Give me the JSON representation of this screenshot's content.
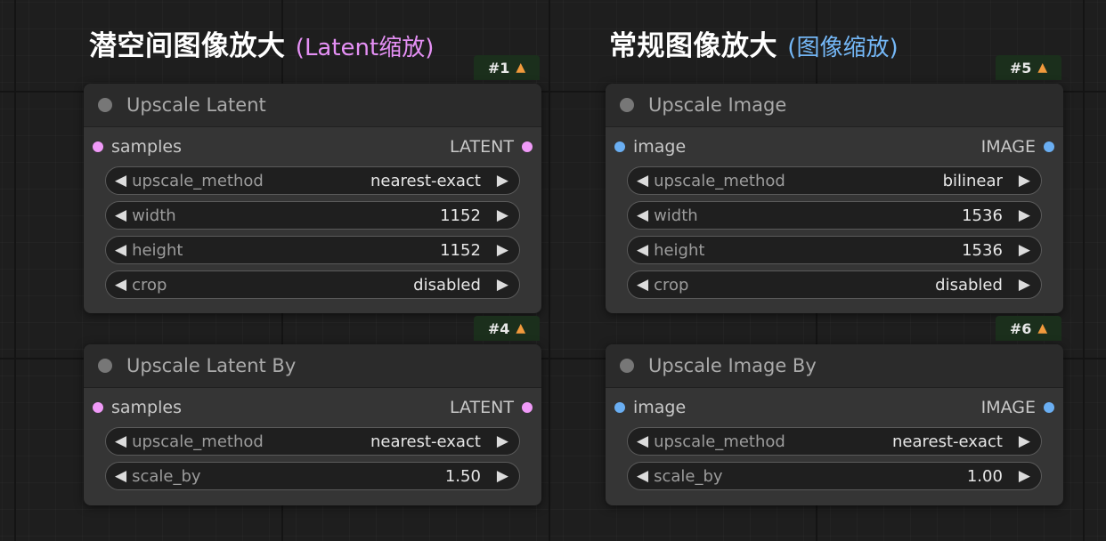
{
  "left_group": {
    "heading": "潜空间图像放大",
    "subheading": "(Latent缩放)",
    "nodes": [
      {
        "badge": "#1",
        "title": "Upscale Latent",
        "input_label": "samples",
        "output_label": "LATENT",
        "widgets": [
          {
            "name": "upscale_method",
            "value": "nearest-exact"
          },
          {
            "name": "width",
            "value": "1152"
          },
          {
            "name": "height",
            "value": "1152"
          },
          {
            "name": "crop",
            "value": "disabled"
          }
        ]
      },
      {
        "badge": "#4",
        "title": "Upscale Latent By",
        "input_label": "samples",
        "output_label": "LATENT",
        "widgets": [
          {
            "name": "upscale_method",
            "value": "nearest-exact"
          },
          {
            "name": "scale_by",
            "value": "1.50"
          }
        ]
      }
    ]
  },
  "right_group": {
    "heading": "常规图像放大",
    "subheading": "(图像缩放)",
    "nodes": [
      {
        "badge": "#5",
        "title": "Upscale Image",
        "input_label": "image",
        "output_label": "IMAGE",
        "widgets": [
          {
            "name": "upscale_method",
            "value": "bilinear"
          },
          {
            "name": "width",
            "value": "1536"
          },
          {
            "name": "height",
            "value": "1536"
          },
          {
            "name": "crop",
            "value": "disabled"
          }
        ]
      },
      {
        "badge": "#6",
        "title": "Upscale Image By",
        "input_label": "image",
        "output_label": "IMAGE",
        "widgets": [
          {
            "name": "upscale_method",
            "value": "nearest-exact"
          },
          {
            "name": "scale_by",
            "value": "1.00"
          }
        ]
      }
    ]
  },
  "icons": {
    "badge_icon": "fox-icon",
    "collapse_icon": "node-collapse-dot-icon",
    "decrement_icon": "arrow-left-icon",
    "increment_icon": "arrow-right-icon"
  },
  "colors": {
    "latent_slot": "#f09af8",
    "image_slot": "#6aaef2",
    "left_subheading": "#e590f5",
    "right_subheading": "#74b7f6",
    "badge_bg": "#1b2f1c"
  }
}
